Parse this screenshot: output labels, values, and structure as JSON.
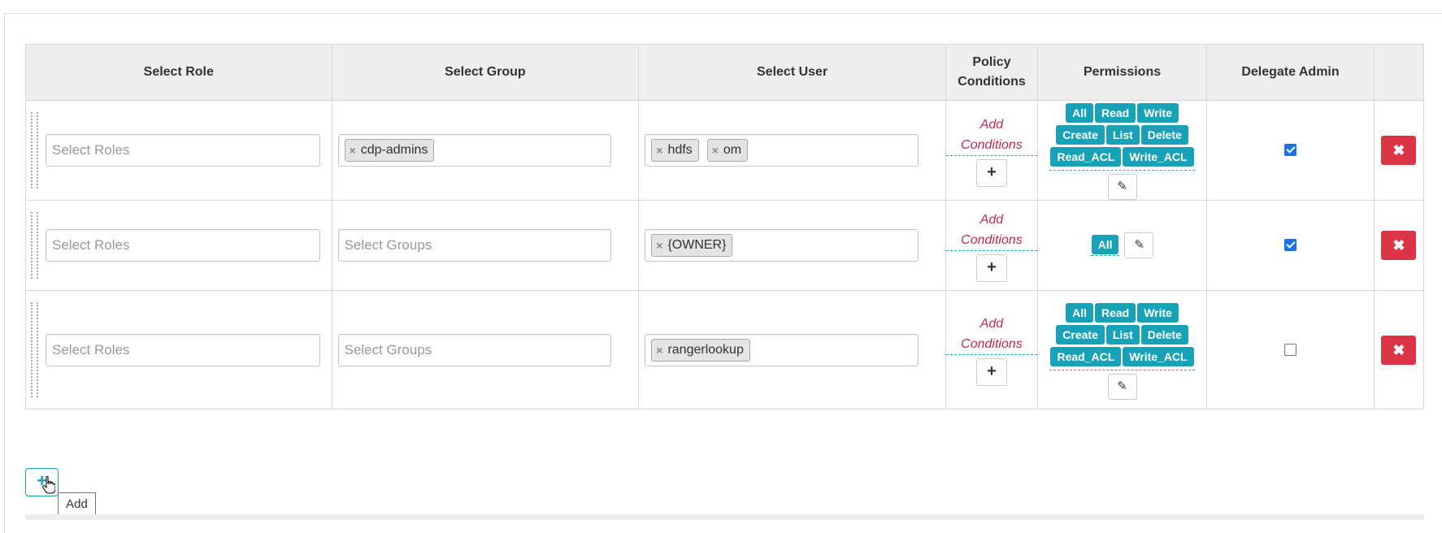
{
  "table": {
    "headers": [
      "Select Role",
      "Select Group",
      "Select User",
      "Policy Conditions",
      "Permissions",
      "Delegate Admin",
      ""
    ],
    "rows": [
      {
        "role_placeholder": "Select Roles",
        "groups": [
          "cdp-admins"
        ],
        "group_placeholder": "",
        "users": [
          "hdfs",
          "om"
        ],
        "condition_link": "Add Conditions",
        "permissions": [
          "All",
          "Read",
          "Write",
          "Create",
          "List",
          "Delete",
          "Read_ACL",
          "Write_ACL"
        ],
        "delegate_admin": true
      },
      {
        "role_placeholder": "Select Roles",
        "groups": [],
        "group_placeholder": "Select Groups",
        "users": [
          "{OWNER}"
        ],
        "condition_link": "Add Conditions",
        "permissions": [
          "All"
        ],
        "delegate_admin": true
      },
      {
        "role_placeholder": "Select Roles",
        "groups": [],
        "group_placeholder": "Select Groups",
        "users": [
          "rangerlookup"
        ],
        "condition_link": "Add Conditions",
        "permissions": [
          "All",
          "Read",
          "Write",
          "Create",
          "List",
          "Delete",
          "Read_ACL",
          "Write_ACL"
        ],
        "delegate_admin": false
      }
    ]
  },
  "add_button": {
    "label": "+",
    "tooltip": "Add"
  },
  "icons": {
    "remove_tag": "×",
    "add_condition": "+",
    "edit": "✎",
    "delete": "✖"
  },
  "colors": {
    "permission_badge": "#17a2b8",
    "delete_button": "#dc3545",
    "condition_link": "#c7254e"
  }
}
